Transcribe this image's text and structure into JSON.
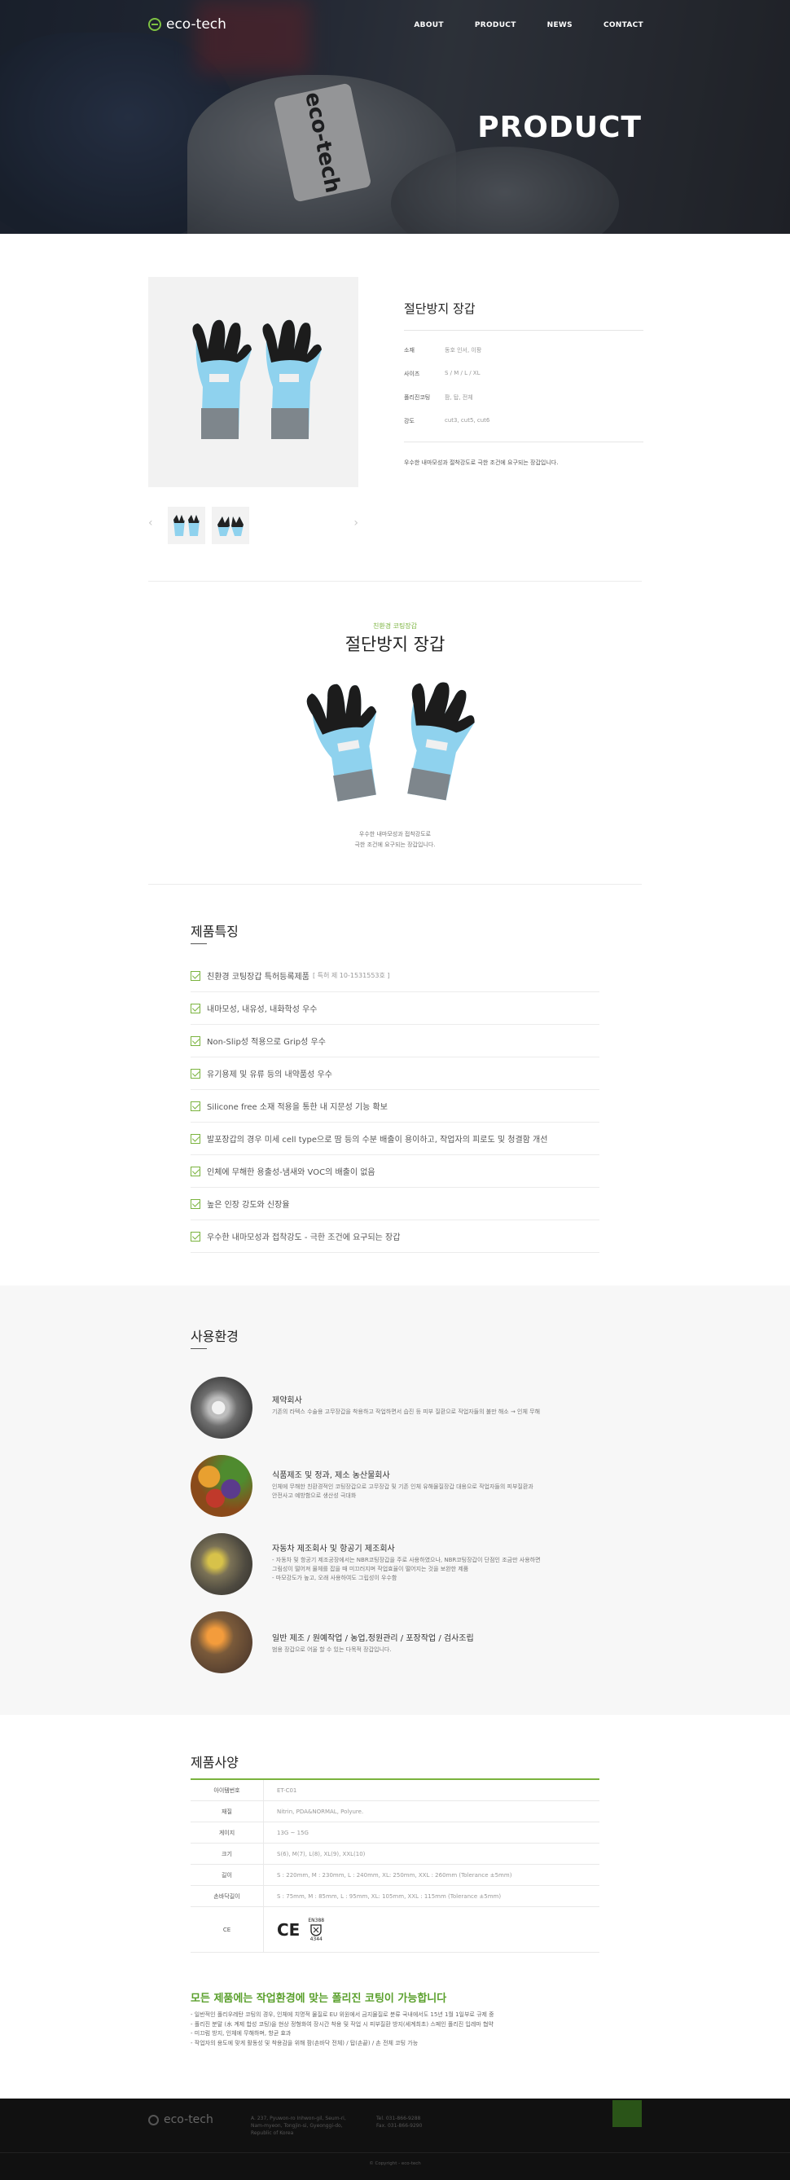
{
  "header": {
    "logo_text": "eco-tech",
    "nav": [
      "ABOUT",
      "PRODUCT",
      "NEWS",
      "CONTACT"
    ],
    "hero_title": "PRODUCT",
    "hero_label_text": "eco-tech"
  },
  "product": {
    "name": "절단방지 장갑",
    "specs": [
      {
        "k": "소재",
        "v": "동호 인서, 이팡"
      },
      {
        "k": "사이즈",
        "v": "S / M / L / XL"
      },
      {
        "k": "폴리진코팅",
        "v": "팜, 탑, 전체"
      },
      {
        "k": "강도",
        "v": "cut3, cut5, cut6"
      }
    ],
    "description": "우수한 내마모성과 절착강도로 극한 조건에 요구되는 장갑입니다."
  },
  "intro": {
    "eyebrow": "친환경 코팅장갑",
    "title": "절단방지 장갑",
    "desc_lines": [
      "우수한 내마모성과 접착강도로",
      "극한 조건에 요구되는 장갑입니다."
    ]
  },
  "features": {
    "title": "제품특징",
    "items": [
      {
        "text": "친환경 코팅장갑 특허등록제품",
        "sub": "[ 특허 제 10-1531553호 ]"
      },
      {
        "text": "내마모성, 내유성, 내화학성 우수",
        "sub": ""
      },
      {
        "text": "Non-Slip성 적용으로 Grip성 우수",
        "sub": ""
      },
      {
        "text": "유기용제 및 유류 등의 내약품성 우수",
        "sub": ""
      },
      {
        "text": "Silicone free 소재 적용을 통한 내 지문성 기능 확보",
        "sub": ""
      },
      {
        "text": "발포장갑의 경우 미세 cell type으로 땀 등의 수분 배출이 용이하고, 작업자의 피로도 및 청결함 개선",
        "sub": ""
      },
      {
        "text": "인체에 무해한 용출성-냄새와 VOC의 배출이 없음",
        "sub": ""
      },
      {
        "text": "높은 인장 강도와 신장율",
        "sub": ""
      },
      {
        "text": "우수한 내마모성과 접착강도 - 극한 조건에 요구되는 장갑",
        "sub": ""
      }
    ]
  },
  "environment": {
    "title": "사용환경",
    "items": [
      {
        "title": "제약회사",
        "desc": [
          "기존의 라텍스 수술용 고무장갑을 착용하고 작업하면서 습진 등 피부 질환으로 작업자들의 불만 해소 → 인체 무해"
        ]
      },
      {
        "title": "식품제조 및 정과, 제소 농산물회사",
        "desc": [
          "인체에 무해한 친환경적인 코팅장갑으로 고무장갑 및 기존 인체 유해물질장갑 대용으로 작업자들의 피부질환과",
          "안전사고 예방함으로 생산성 극대화"
        ]
      },
      {
        "title": "자동차 제조회사 및 항공기 제조회사",
        "desc": [
          "- 자동차 및 항공기 제조공장에서는 NBR코팅장갑을 주로 사용하였으나, NBR코팅장갑이 단점인 조금만 사용하면",
          "  그림성이 떨어져 물체를 잡을 때 미끄러지며 작업효율이 떨어지는 것을 보완한 제품",
          "- 마모강도가 높고, 오래 사용하여도 그립성이 우수함"
        ]
      },
      {
        "title": "일반 제조 / 원예작업 / 농업,정원관리 / 포장작업 / 검사조립",
        "desc": [
          "범용 장갑으로 어울 할 수 있는 다목적 장갑입니다."
        ]
      }
    ]
  },
  "spec_table": {
    "title": "제품사양",
    "rows": [
      {
        "k": "아이템번호",
        "v": "ET-C01"
      },
      {
        "k": "재질",
        "v": "Nitrin, PDA&NORMAL, Polyure."
      },
      {
        "k": "게이지",
        "v": "13G ~ 15G"
      },
      {
        "k": "크기",
        "v": "S(6), M(7), L(8), XL(9), XXL(10)"
      },
      {
        "k": "길이",
        "v": "S : 220mm, M : 230mm, L : 240mm, XL: 250mm, XXL : 260mm (Tolerance ±5mm)"
      },
      {
        "k": "손바닥길이",
        "v": "S : 75mm, M : 85mm, L : 95mm, XL: 105mm, XXL : 115mm (Tolerance ±5mm)"
      },
      {
        "k": "CE",
        "v": ""
      }
    ],
    "ce_mark": "CE",
    "en_mark": "EN388",
    "en_code": "4344"
  },
  "coating": {
    "title": "모든 제품에는 작업환경에 맞는 폴리진 코팅이 가능합니다",
    "notes": [
      "- 일반적인 폴리우레탄 코팅의 경우, 인체에 치명적 물질로 EU 위원에서 금지물질로 분류 국내에서도 15년 1월 1일부로 규제 중",
      "- 폴리진 분말 (水 계제 합성 코팅)을 현상 정형화여 장시간 착용 및 작업 시 피부질환 방지(세계최초) 스페인 폴리진 입레마 협약",
      "- 미끄럼 방지, 인체에 무해하며, 항균 효과",
      "- 작업자의 용도에 맞게 활동성 및 착용감을 위해 팜(손바닥 전체) / 탑(손끝) / 손 전체 코팅 가능"
    ]
  },
  "footer": {
    "logo_text": "eco-tech",
    "address": [
      "A. 237, Pyuwon-ro Inhwon-gil, Seum-ri,",
      "Nam-myeon, Tongjin-si, Gyeonggi-do,",
      "Republic of Korea"
    ],
    "contact": [
      "Tel. 031-866-9288",
      "Fax. 031-866-9290"
    ],
    "copyright": "© Copyright - eco-tech"
  },
  "colors": {
    "accent": "#7ab33e",
    "dark": "#111111",
    "glove_blue": "#8fd2ee"
  }
}
